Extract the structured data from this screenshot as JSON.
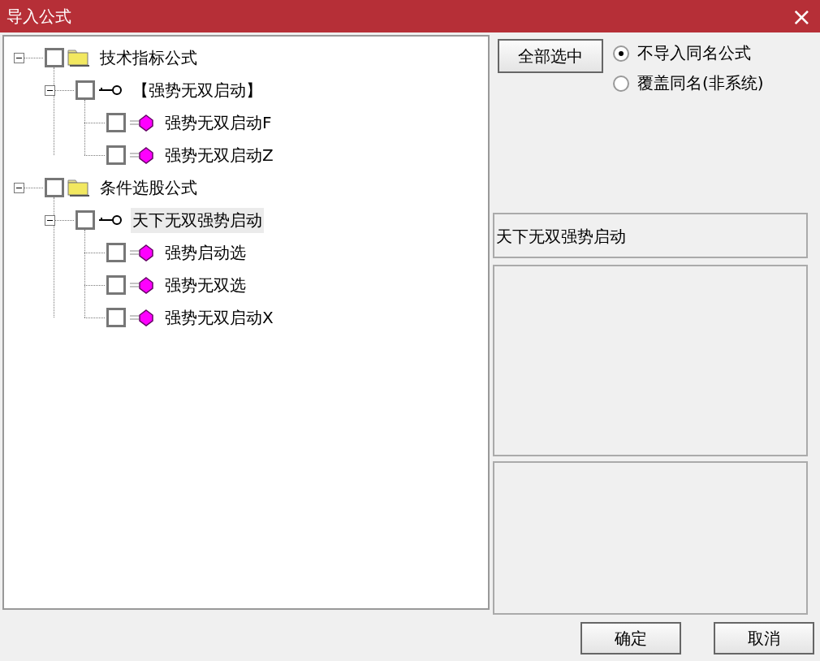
{
  "window": {
    "title": "导入公式",
    "close": "×"
  },
  "tree": [
    {
      "label": "技术指标公式",
      "kind": "folder",
      "checked": false,
      "selected": false,
      "expanded": true,
      "children": [
        {
          "label": "【强势无双启动】",
          "kind": "group",
          "checked": false,
          "selected": false,
          "expanded": true,
          "children": [
            {
              "label": "强势无双启动F",
              "kind": "formula",
              "checked": false,
              "selected": false
            },
            {
              "label": "强势无双启动Z",
              "kind": "formula",
              "checked": false,
              "selected": false
            }
          ]
        }
      ]
    },
    {
      "label": "条件选股公式",
      "kind": "folder",
      "checked": false,
      "selected": false,
      "expanded": true,
      "children": [
        {
          "label": "天下无双强势启动",
          "kind": "group",
          "checked": false,
          "selected": true,
          "expanded": true,
          "children": [
            {
              "label": "强势启动选",
              "kind": "formula",
              "checked": false,
              "selected": false
            },
            {
              "label": "强势无双选",
              "kind": "formula",
              "checked": false,
              "selected": false
            },
            {
              "label": "强势无双启动X",
              "kind": "formula",
              "checked": false,
              "selected": false
            }
          ]
        }
      ]
    }
  ],
  "select_all_button": "全部选中",
  "import_options": [
    {
      "label": "不导入同名公式",
      "selected": true
    },
    {
      "label": "覆盖同名(非系统)",
      "selected": false
    }
  ],
  "name_field": {
    "value": "天下无双强势启动"
  },
  "buttons": [
    "确定",
    "取消"
  ]
}
